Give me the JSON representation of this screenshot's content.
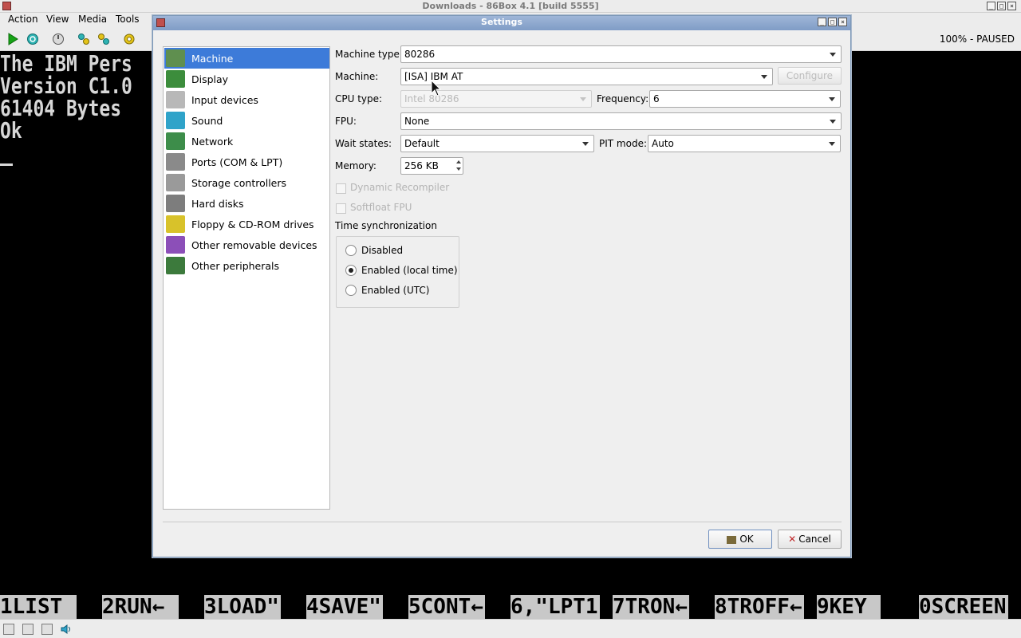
{
  "window": {
    "title": "Downloads - 86Box 4.1 [build 5555]"
  },
  "menubar": {
    "items": [
      "Action",
      "View",
      "Media",
      "Tools"
    ]
  },
  "toolbar": {
    "status": "100% - PAUSED"
  },
  "screen": {
    "lines": [
      "The IBM Pers",
      "Version C1.0",
      "61404 Bytes",
      "Ok"
    ],
    "fkeys": [
      "1LIST",
      "2RUN←",
      "3LOAD\"",
      "4SAVE\"",
      "5CONT←",
      "6,\"LPT1",
      "7TRON←",
      "8TROFF←",
      "9KEY",
      "0SCREEN"
    ]
  },
  "dialog": {
    "title": "Settings",
    "nav": [
      {
        "label": "Machine",
        "icon": "motherboard-icon",
        "selected": true
      },
      {
        "label": "Display",
        "icon": "display-card-icon"
      },
      {
        "label": "Input devices",
        "icon": "input-devices-icon"
      },
      {
        "label": "Sound",
        "icon": "sound-icon"
      },
      {
        "label": "Network",
        "icon": "network-icon"
      },
      {
        "label": "Ports (COM & LPT)",
        "icon": "ports-icon"
      },
      {
        "label": "Storage controllers",
        "icon": "storage-controllers-icon"
      },
      {
        "label": "Hard disks",
        "icon": "hard-disk-icon"
      },
      {
        "label": "Floppy & CD-ROM drives",
        "icon": "floppy-cdrom-icon"
      },
      {
        "label": "Other removable devices",
        "icon": "removable-devices-icon"
      },
      {
        "label": "Other peripherals",
        "icon": "peripherals-icon"
      }
    ],
    "form": {
      "machine_type_label": "Machine type:",
      "machine_type_value": "80286",
      "machine_label": "Machine:",
      "machine_value": "[ISA] IBM AT",
      "configure_label": "Configure",
      "cpu_type_label": "CPU type:",
      "cpu_type_value": "Intel 80286",
      "frequency_label": "Frequency:",
      "frequency_value": "6",
      "fpu_label": "FPU:",
      "fpu_value": "None",
      "wait_states_label": "Wait states:",
      "wait_states_value": "Default",
      "pit_mode_label": "PIT mode:",
      "pit_mode_value": "Auto",
      "memory_label": "Memory:",
      "memory_value": "256 KB",
      "dynamic_recompiler_label": "Dynamic Recompiler",
      "softfloat_label": "Softfloat FPU",
      "time_sync_label": "Time synchronization",
      "time_sync_options": [
        "Disabled",
        "Enabled (local time)",
        "Enabled (UTC)"
      ],
      "time_sync_selected": 1
    },
    "buttons": {
      "ok": "OK",
      "cancel": "Cancel"
    }
  }
}
